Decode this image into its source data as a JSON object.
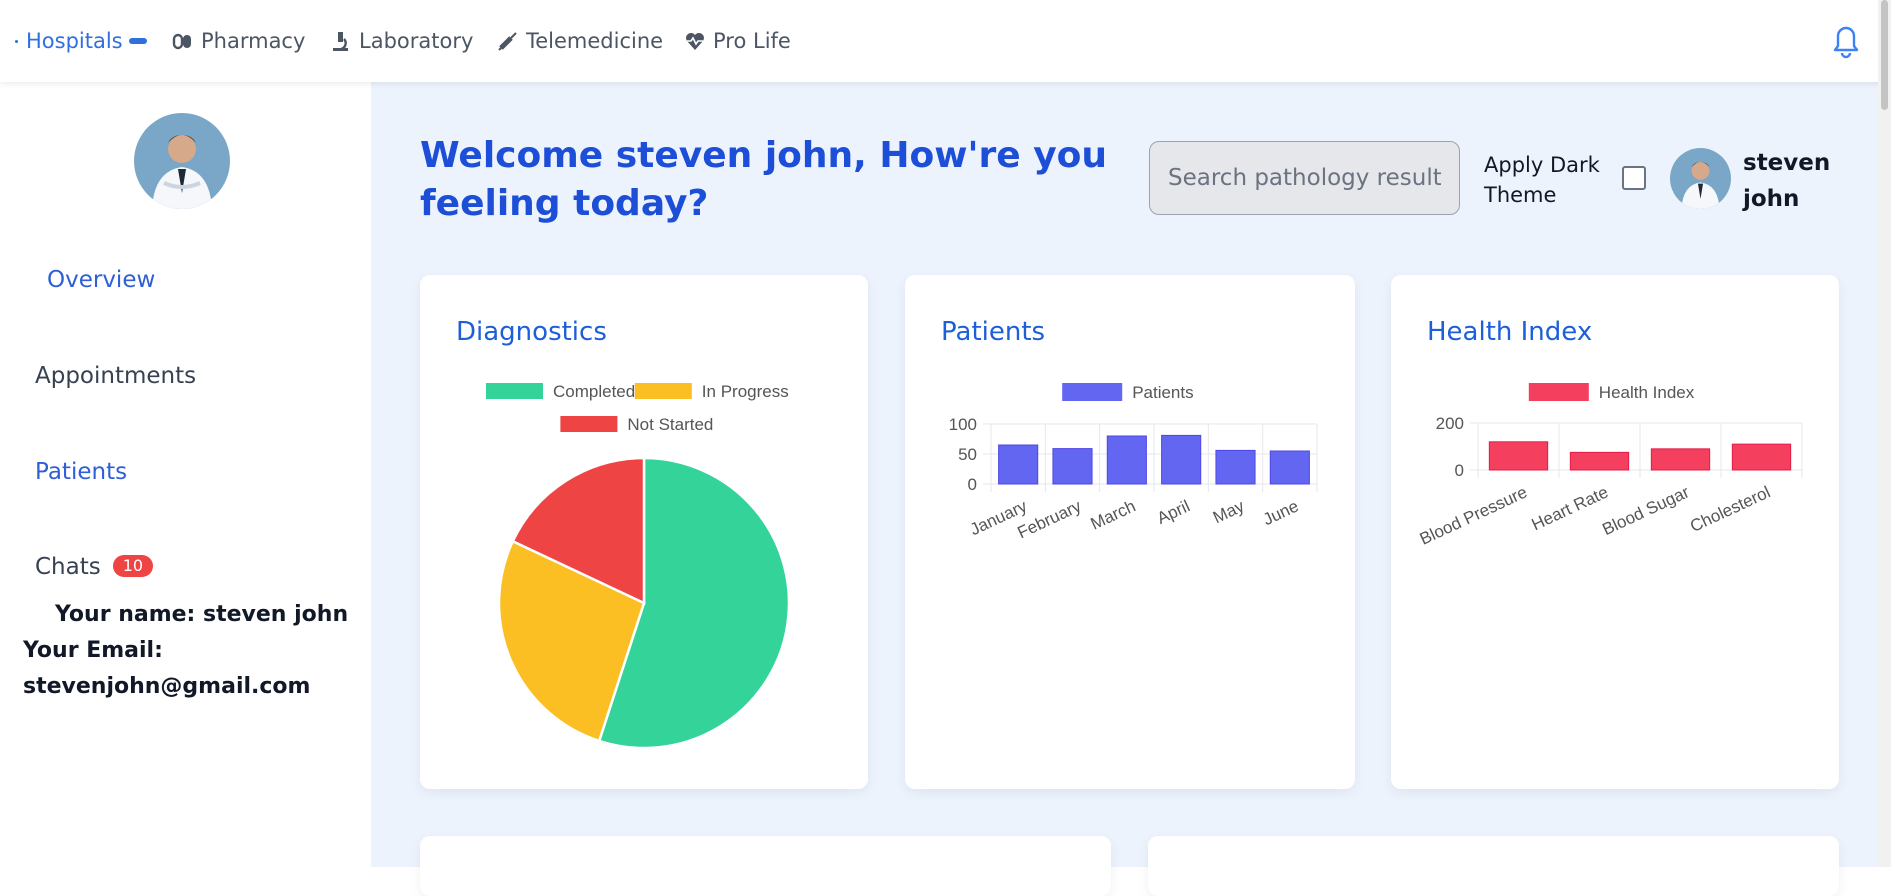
{
  "nav": {
    "items": [
      {
        "label": "Hospitals",
        "icon": "hospital-icon"
      },
      {
        "label": "Pharmacy",
        "icon": "pills-icon"
      },
      {
        "label": "Laboratory",
        "icon": "microscope-icon"
      },
      {
        "label": "Telemedicine",
        "icon": "syringe-icon"
      },
      {
        "label": "Pro Life",
        "icon": "heart-pulse-icon"
      }
    ],
    "active_index": 0,
    "notification_icon": "bell-icon"
  },
  "sidebar": {
    "overview": "Overview",
    "appointments": "Appointments",
    "patients": "Patients",
    "chats": "Chats",
    "chats_count": "10",
    "name_line": "Your name: steven john",
    "email_label": "Your Email:",
    "email_value": "stevenjohn@gmail.com"
  },
  "header": {
    "welcome": "Welcome steven john, How're you feeling today?",
    "search_placeholder": "Search pathology results",
    "dark_theme_label": "Apply Dark Theme",
    "dark_theme_checked": false,
    "user_name": "steven john"
  },
  "colors": {
    "accent": "#1d4ed8",
    "completed": "#34d399",
    "in_progress": "#fbbf24",
    "not_started": "#ef4444",
    "patients_bar": "#6366f1",
    "health_bar": "#f43f5e",
    "badge": "#ef4444"
  },
  "cards": {
    "diagnostics_title": "Diagnostics",
    "patients_title": "Patients",
    "health_title": "Health Index"
  },
  "chart_data": [
    {
      "type": "pie",
      "title": "Diagnostics",
      "categories": [
        "Completed",
        "In Progress",
        "Not Started"
      ],
      "values": [
        55,
        27,
        18
      ],
      "colors": [
        "#34d399",
        "#fbbf24",
        "#ef4444"
      ],
      "legend": "top"
    },
    {
      "type": "bar",
      "title": "Patients",
      "categories": [
        "January",
        "February",
        "March",
        "April",
        "May",
        "June"
      ],
      "series": [
        {
          "name": "Patients",
          "values": [
            65,
            59,
            80,
            81,
            56,
            55
          ]
        }
      ],
      "ylim": [
        0,
        100
      ],
      "yticks": [
        0,
        50,
        100
      ],
      "grid": true,
      "legend": "top"
    },
    {
      "type": "bar",
      "title": "Health Index",
      "categories": [
        "Blood Pressure",
        "Heart Rate",
        "Blood Sugar",
        "Cholesterol"
      ],
      "series": [
        {
          "name": "Health Index",
          "values": [
            120,
            75,
            90,
            110
          ]
        }
      ],
      "ylim": [
        0,
        200
      ],
      "yticks": [
        0,
        200
      ],
      "grid": true,
      "legend": "top"
    }
  ]
}
